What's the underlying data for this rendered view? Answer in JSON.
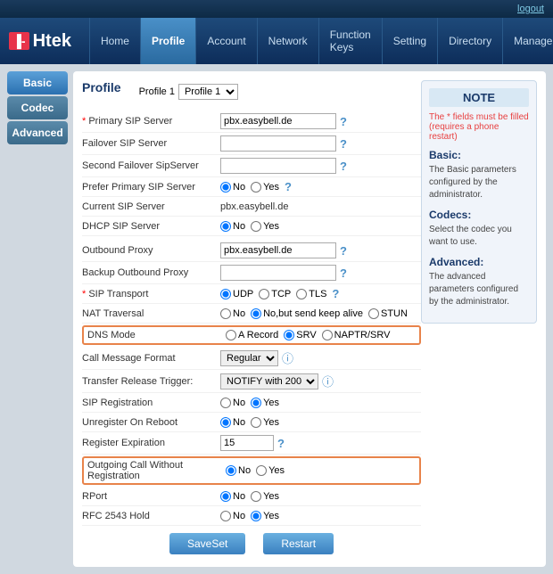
{
  "topbar": {
    "logout_label": "logout"
  },
  "header": {
    "logo_box": "F",
    "logo_text": "Htek"
  },
  "nav": {
    "items": [
      {
        "label": "Home",
        "active": false
      },
      {
        "label": "Profile",
        "active": true
      },
      {
        "label": "Account",
        "active": false
      },
      {
        "label": "Network",
        "active": false
      },
      {
        "label": "Function Keys",
        "active": false
      },
      {
        "label": "Setting",
        "active": false
      },
      {
        "label": "Directory",
        "active": false
      },
      {
        "label": "Management",
        "active": false
      }
    ]
  },
  "sidebar": {
    "items": [
      {
        "label": "Basic",
        "active": true
      },
      {
        "label": "Codec",
        "active": false
      },
      {
        "label": "Advanced",
        "active": false
      }
    ]
  },
  "content": {
    "title": "Profile",
    "profile_label": "Profile",
    "profile_value": "Profile 1",
    "fields": [
      {
        "label": "Primary SIP Server",
        "required": true,
        "type": "text_help",
        "value": "pbx.easybell.de",
        "help": true
      },
      {
        "label": "Failover SIP Server",
        "required": false,
        "type": "text_help",
        "value": "",
        "help": true
      },
      {
        "label": "Second Failover SipServer",
        "required": false,
        "type": "text_help",
        "value": "",
        "help": true
      },
      {
        "label": "Prefer Primary SIP Server",
        "required": false,
        "type": "radio_yesno",
        "selected": "No"
      },
      {
        "label": "Current SIP Server",
        "required": false,
        "type": "static",
        "value": "pbx.easybell.de"
      },
      {
        "label": "DHCP SIP Server",
        "required": false,
        "type": "radio_yesno_nohelp",
        "selected": "No"
      },
      {
        "label": "Outbound Proxy",
        "required": false,
        "type": "text_help",
        "value": "pbx.easybell.de",
        "help": true
      },
      {
        "label": "Backup Outbound Proxy",
        "required": false,
        "type": "text_help",
        "value": "",
        "help": true
      },
      {
        "label": "SIP Transport",
        "required": true,
        "type": "radio_transport"
      },
      {
        "label": "NAT Traversal",
        "required": false,
        "type": "nat_traversal"
      },
      {
        "label": "DNS Mode",
        "required": false,
        "type": "dns_mode",
        "highlighted": true
      },
      {
        "label": "Call Message Format",
        "required": false,
        "type": "call_msg_format"
      },
      {
        "label": "Transfer Release Trigger:",
        "required": false,
        "type": "transfer_trigger"
      },
      {
        "label": "SIP Registration",
        "required": false,
        "type": "radio_yesno_plain",
        "selected": "Yes"
      },
      {
        "label": "Unregister On Reboot",
        "required": false,
        "type": "radio_yesno_plain",
        "selected": "No"
      },
      {
        "label": "Register Expiration",
        "required": false,
        "type": "expire_field"
      },
      {
        "label": "Outgoing Call Without Registration",
        "required": false,
        "type": "outgoing_call",
        "highlighted": true,
        "selected": "No"
      },
      {
        "label": "RPort",
        "required": false,
        "type": "radio_yesno_plain_no",
        "selected": "No"
      },
      {
        "label": "RFC 2543 Hold",
        "required": false,
        "type": "radio_yesno_plain",
        "selected": "Yes"
      }
    ],
    "buttons": {
      "save": "SaveSet",
      "restart": "Restart"
    }
  },
  "note": {
    "title": "NOTE",
    "required_text": "The * fields must be filled (requires a phone restart)",
    "sections": [
      {
        "title": "Basic:",
        "text": "The Basic parameters configured by the administrator."
      },
      {
        "title": "Codecs:",
        "text": "Select the codec you want to use."
      },
      {
        "title": "Advanced:",
        "text": "The advanced parameters configured by the administrator."
      }
    ]
  }
}
